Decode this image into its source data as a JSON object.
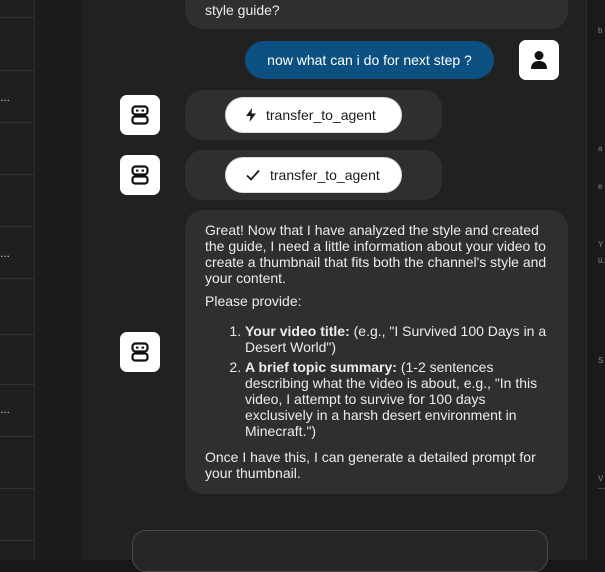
{
  "sidebar": {
    "ellipsis": "..."
  },
  "rightbar": {
    "marks": [
      "b",
      "a",
      "e",
      "Y",
      "u",
      "S",
      "V"
    ]
  },
  "messages": {
    "prev_text_tail": "style guide?",
    "user_message": "now what can i do for next step ?",
    "tool_calls": [
      {
        "label": "transfer_to_agent",
        "icon": "bolt-icon"
      },
      {
        "label": "transfer_to_agent",
        "icon": "check-icon"
      }
    ],
    "assistant": {
      "intro": "Great! Now that I have analyzed the style and created the guide, I need a little information about your video to create a thumbnail that fits both the channel's style and your content.",
      "please": "Please provide:",
      "items": [
        {
          "bold": "Your video title:",
          "rest": " (e.g., \"I Survived 100 Days in a Desert World\")"
        },
        {
          "bold": "A brief topic summary:",
          "rest": " (1-2 sentences describing what the video is about, e.g., \"In this video, I attempt to survive for 100 days exclusively in a harsh desert environment in Minecraft.\")"
        }
      ],
      "outro": "Once I have this, I can generate a detailed prompt for your thumbnail."
    }
  },
  "colors": {
    "user_bubble": "#0b5080",
    "bubble": "#2f2f2f",
    "background": "#212121"
  }
}
